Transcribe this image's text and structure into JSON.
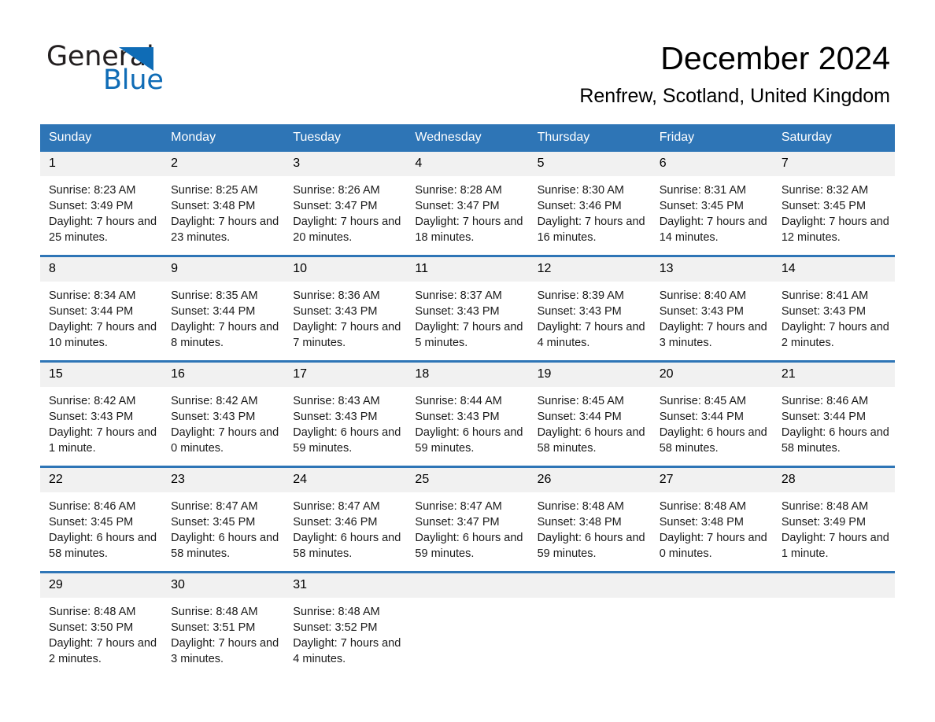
{
  "brand": {
    "name_part1": "General",
    "name_part2": "Blue",
    "logo_icon": "triangle-logo-icon",
    "accent_color": "#0f6cb6"
  },
  "header": {
    "title": "December 2024",
    "subtitle": "Renfrew, Scotland, United Kingdom"
  },
  "colors": {
    "header_row_bg": "#2e75b6",
    "daynum_bg": "#f1f1f1",
    "row_divider": "#2e75b6",
    "text": "#000000"
  },
  "calendar": {
    "weekday_headers": [
      "Sunday",
      "Monday",
      "Tuesday",
      "Wednesday",
      "Thursday",
      "Friday",
      "Saturday"
    ],
    "weeks": [
      [
        {
          "day": "1",
          "details": "Sunrise: 8:23 AM\nSunset: 3:49 PM\nDaylight: 7 hours and 25 minutes."
        },
        {
          "day": "2",
          "details": "Sunrise: 8:25 AM\nSunset: 3:48 PM\nDaylight: 7 hours and 23 minutes."
        },
        {
          "day": "3",
          "details": "Sunrise: 8:26 AM\nSunset: 3:47 PM\nDaylight: 7 hours and 20 minutes."
        },
        {
          "day": "4",
          "details": "Sunrise: 8:28 AM\nSunset: 3:47 PM\nDaylight: 7 hours and 18 minutes."
        },
        {
          "day": "5",
          "details": "Sunrise: 8:30 AM\nSunset: 3:46 PM\nDaylight: 7 hours and 16 minutes."
        },
        {
          "day": "6",
          "details": "Sunrise: 8:31 AM\nSunset: 3:45 PM\nDaylight: 7 hours and 14 minutes."
        },
        {
          "day": "7",
          "details": "Sunrise: 8:32 AM\nSunset: 3:45 PM\nDaylight: 7 hours and 12 minutes."
        }
      ],
      [
        {
          "day": "8",
          "details": "Sunrise: 8:34 AM\nSunset: 3:44 PM\nDaylight: 7 hours and 10 minutes."
        },
        {
          "day": "9",
          "details": "Sunrise: 8:35 AM\nSunset: 3:44 PM\nDaylight: 7 hours and 8 minutes."
        },
        {
          "day": "10",
          "details": "Sunrise: 8:36 AM\nSunset: 3:43 PM\nDaylight: 7 hours and 7 minutes."
        },
        {
          "day": "11",
          "details": "Sunrise: 8:37 AM\nSunset: 3:43 PM\nDaylight: 7 hours and 5 minutes."
        },
        {
          "day": "12",
          "details": "Sunrise: 8:39 AM\nSunset: 3:43 PM\nDaylight: 7 hours and 4 minutes."
        },
        {
          "day": "13",
          "details": "Sunrise: 8:40 AM\nSunset: 3:43 PM\nDaylight: 7 hours and 3 minutes."
        },
        {
          "day": "14",
          "details": "Sunrise: 8:41 AM\nSunset: 3:43 PM\nDaylight: 7 hours and 2 minutes."
        }
      ],
      [
        {
          "day": "15",
          "details": "Sunrise: 8:42 AM\nSunset: 3:43 PM\nDaylight: 7 hours and 1 minute."
        },
        {
          "day": "16",
          "details": "Sunrise: 8:42 AM\nSunset: 3:43 PM\nDaylight: 7 hours and 0 minutes."
        },
        {
          "day": "17",
          "details": "Sunrise: 8:43 AM\nSunset: 3:43 PM\nDaylight: 6 hours and 59 minutes."
        },
        {
          "day": "18",
          "details": "Sunrise: 8:44 AM\nSunset: 3:43 PM\nDaylight: 6 hours and 59 minutes."
        },
        {
          "day": "19",
          "details": "Sunrise: 8:45 AM\nSunset: 3:44 PM\nDaylight: 6 hours and 58 minutes."
        },
        {
          "day": "20",
          "details": "Sunrise: 8:45 AM\nSunset: 3:44 PM\nDaylight: 6 hours and 58 minutes."
        },
        {
          "day": "21",
          "details": "Sunrise: 8:46 AM\nSunset: 3:44 PM\nDaylight: 6 hours and 58 minutes."
        }
      ],
      [
        {
          "day": "22",
          "details": "Sunrise: 8:46 AM\nSunset: 3:45 PM\nDaylight: 6 hours and 58 minutes."
        },
        {
          "day": "23",
          "details": "Sunrise: 8:47 AM\nSunset: 3:45 PM\nDaylight: 6 hours and 58 minutes."
        },
        {
          "day": "24",
          "details": "Sunrise: 8:47 AM\nSunset: 3:46 PM\nDaylight: 6 hours and 58 minutes."
        },
        {
          "day": "25",
          "details": "Sunrise: 8:47 AM\nSunset: 3:47 PM\nDaylight: 6 hours and 59 minutes."
        },
        {
          "day": "26",
          "details": "Sunrise: 8:48 AM\nSunset: 3:48 PM\nDaylight: 6 hours and 59 minutes."
        },
        {
          "day": "27",
          "details": "Sunrise: 8:48 AM\nSunset: 3:48 PM\nDaylight: 7 hours and 0 minutes."
        },
        {
          "day": "28",
          "details": "Sunrise: 8:48 AM\nSunset: 3:49 PM\nDaylight: 7 hours and 1 minute."
        }
      ],
      [
        {
          "day": "29",
          "details": "Sunrise: 8:48 AM\nSunset: 3:50 PM\nDaylight: 7 hours and 2 minutes."
        },
        {
          "day": "30",
          "details": "Sunrise: 8:48 AM\nSunset: 3:51 PM\nDaylight: 7 hours and 3 minutes."
        },
        {
          "day": "31",
          "details": "Sunrise: 8:48 AM\nSunset: 3:52 PM\nDaylight: 7 hours and 4 minutes."
        },
        {
          "day": "",
          "details": ""
        },
        {
          "day": "",
          "details": ""
        },
        {
          "day": "",
          "details": ""
        },
        {
          "day": "",
          "details": ""
        }
      ]
    ]
  }
}
